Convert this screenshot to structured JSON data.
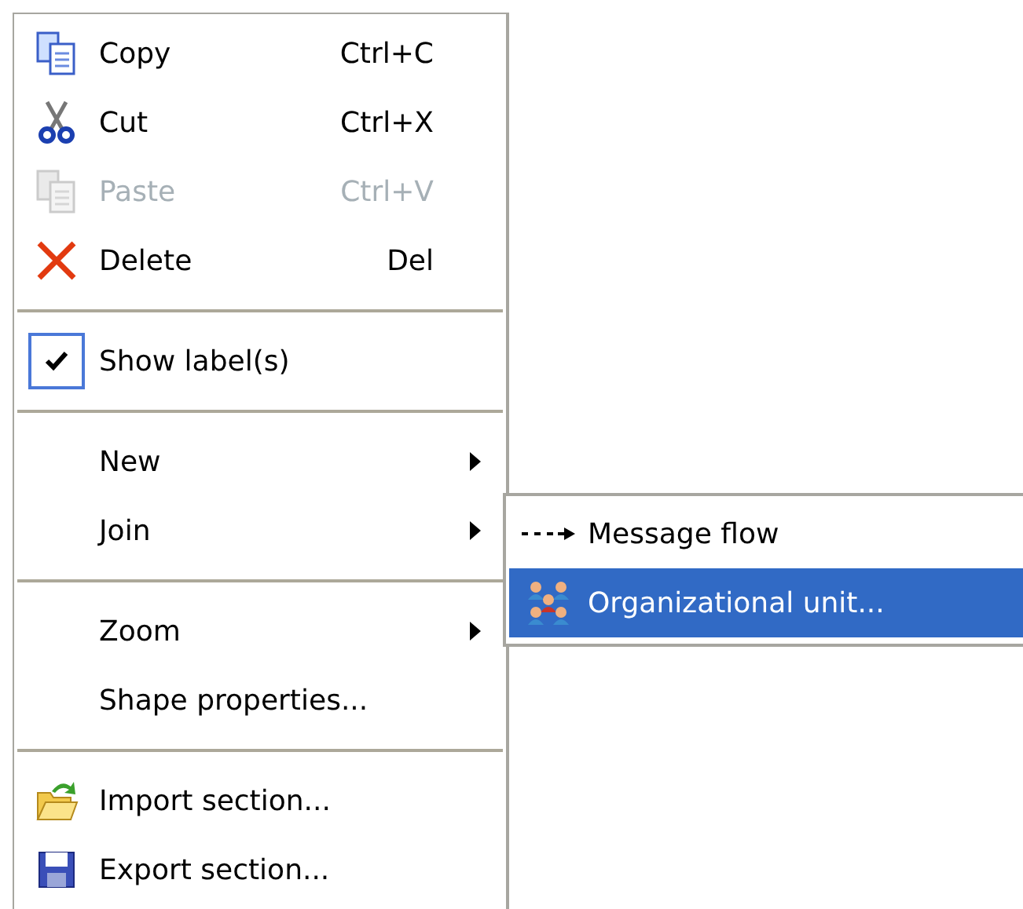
{
  "menu": {
    "items": [
      {
        "kind": "copy",
        "label": "Copy",
        "shortcut": "Ctrl+C",
        "disabled": false
      },
      {
        "kind": "cut",
        "label": "Cut",
        "shortcut": "Ctrl+X",
        "disabled": false
      },
      {
        "kind": "paste",
        "label": "Paste",
        "shortcut": "Ctrl+V",
        "disabled": true
      },
      {
        "kind": "delete",
        "label": "Delete",
        "shortcut": "Del",
        "disabled": false
      },
      {
        "kind": "separator"
      },
      {
        "kind": "check",
        "label": "Show label(s)",
        "checked": true
      },
      {
        "kind": "separator"
      },
      {
        "kind": "parent",
        "label": "New"
      },
      {
        "kind": "parent",
        "label": "Join",
        "submenu": [
          {
            "kind": "arrow",
            "label": "Message flow",
            "selected": false
          },
          {
            "kind": "people",
            "label": "Organizational unit...",
            "selected": true
          }
        ]
      },
      {
        "kind": "separator"
      },
      {
        "kind": "parent",
        "label": "Zoom"
      },
      {
        "kind": "plain",
        "label": "Shape properties..."
      },
      {
        "kind": "separator"
      },
      {
        "kind": "import",
        "label": "Import section..."
      },
      {
        "kind": "export",
        "label": "Export section..."
      }
    ]
  }
}
